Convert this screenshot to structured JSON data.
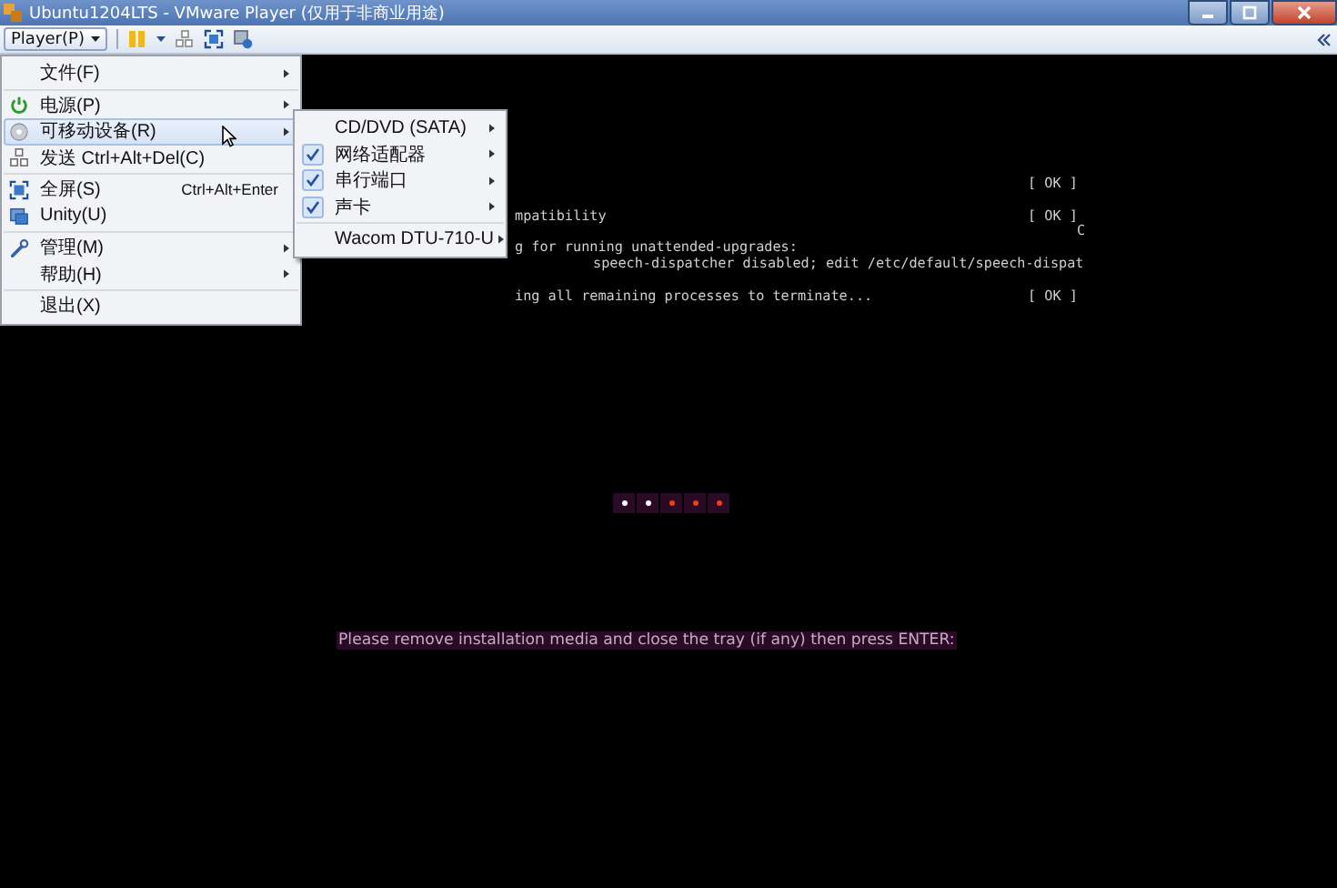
{
  "window": {
    "title": "Ubuntu1204LTS - VMware Player (仅用于非商业用途)"
  },
  "toolbar": {
    "player_menu": "Player(P)"
  },
  "terminal": {
    "lines": [
      {
        "kind": "log",
        "status": "[ OK ]"
      },
      {
        "kind": "log",
        "text": "mpatibility",
        "status": "[ OK ]"
      },
      {
        "kind": "tail",
        "text": "C"
      },
      {
        "kind": "log",
        "text": "g for running unattended-upgrades:"
      },
      {
        "kind": "wrapped",
        "text": "speech-dispatcher disabled; edit /etc/default/speech-dispat"
      },
      {
        "kind": "log",
        "text": "ing all remaining processes to terminate...",
        "status": "[ OK ]"
      }
    ]
  },
  "boot_dots": [
    {
      "color": "#ffffff"
    },
    {
      "color": "#ffffff"
    },
    {
      "color": "#e8401c"
    },
    {
      "color": "#e8401c"
    },
    {
      "color": "#e8401c"
    }
  ],
  "message": "Please remove installation media and close the tray (if any) then press ENTER:",
  "player_menu": {
    "groups": [
      [
        {
          "kind": "plain",
          "label": "文件(F)",
          "submenu": true,
          "selected": false
        }
      ],
      [
        {
          "kind": "power",
          "label": "电源(P)",
          "submenu": true,
          "selected": false
        },
        {
          "kind": "device",
          "label": "可移动设备(R)",
          "submenu": true,
          "selected": true
        },
        {
          "kind": "send",
          "label": "发送 Ctrl+Alt+Del(C)",
          "submenu": false,
          "selected": false
        }
      ],
      [
        {
          "kind": "fullscreen",
          "label": "全屏(S)",
          "shortcut": "Ctrl+Alt+Enter",
          "submenu": false,
          "selected": false
        },
        {
          "kind": "unity",
          "label": "Unity(U)",
          "submenu": false,
          "selected": false
        }
      ],
      [
        {
          "kind": "manage",
          "label": "管理(M)",
          "submenu": true,
          "selected": false
        },
        {
          "kind": "plain",
          "label": "帮助(H)",
          "submenu": true,
          "selected": false
        }
      ],
      [
        {
          "kind": "plain",
          "label": "退出(X)",
          "submenu": false,
          "selected": false
        }
      ]
    ]
  },
  "devices_submenu": {
    "groups": [
      [
        {
          "label": "CD/DVD (SATA)",
          "checked": false
        },
        {
          "label": "网络适配器",
          "checked": true
        },
        {
          "label": "串行端口",
          "checked": true
        },
        {
          "label": "声卡",
          "checked": true
        }
      ],
      [
        {
          "label": "Wacom DTU-710-U",
          "checked": false
        }
      ]
    ]
  }
}
